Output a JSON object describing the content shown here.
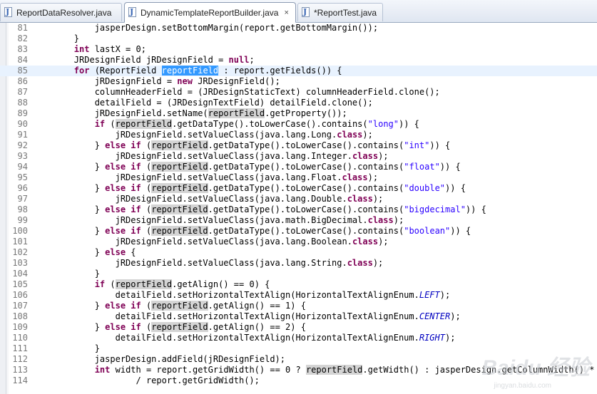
{
  "tabs": [
    {
      "label": "ReportDataResolver.java",
      "active": false
    },
    {
      "label": "DynamicTemplateReportBuilder.java",
      "active": true,
      "close": "×"
    },
    {
      "label": "*ReportTest.java",
      "active": false
    }
  ],
  "lines": [
    {
      "n": "81",
      "t": [
        {
          "s": "            jasperDesign.setBottomMargin(report.getBottomMargin());"
        }
      ]
    },
    {
      "n": "82",
      "t": [
        {
          "s": "        }"
        }
      ]
    },
    {
      "n": "83",
      "t": [
        {
          "s": "        "
        },
        {
          "s": "int",
          "c": "kw"
        },
        {
          "s": " lastX = 0;"
        }
      ]
    },
    {
      "n": "84",
      "t": [
        {
          "s": "        JRDesignField jRDesignField = "
        },
        {
          "s": "null",
          "c": "kw"
        },
        {
          "s": ";"
        }
      ]
    },
    {
      "n": "85",
      "current": true,
      "t": [
        {
          "s": "        "
        },
        {
          "s": "for",
          "c": "kw"
        },
        {
          "s": " (ReportField "
        },
        {
          "s": "reportField",
          "c": "sel"
        },
        {
          "s": " : report.getFields()) {"
        }
      ]
    },
    {
      "n": "86",
      "t": [
        {
          "s": "            jRDesignField = "
        },
        {
          "s": "new",
          "c": "kw"
        },
        {
          "s": " JRDesignField();"
        }
      ]
    },
    {
      "n": "87",
      "t": [
        {
          "s": "            columnHeaderField = (JRDesignStaticText) columnHeaderField.clone();"
        }
      ]
    },
    {
      "n": "88",
      "t": [
        {
          "s": "            detailField = (JRDesignTextField) detailField.clone();"
        }
      ]
    },
    {
      "n": "89",
      "t": [
        {
          "s": "            jRDesignField.setName("
        },
        {
          "s": "reportField",
          "c": "occ"
        },
        {
          "s": ".getProperty());"
        }
      ]
    },
    {
      "n": "90",
      "t": [
        {
          "s": "            "
        },
        {
          "s": "if",
          "c": "kw"
        },
        {
          "s": " ("
        },
        {
          "s": "reportField",
          "c": "occ"
        },
        {
          "s": ".getDataType().toLowerCase().contains("
        },
        {
          "s": "\"long\"",
          "c": "str"
        },
        {
          "s": ")) {"
        }
      ]
    },
    {
      "n": "91",
      "t": [
        {
          "s": "                jRDesignField.setValueClass(java.lang.Long."
        },
        {
          "s": "class",
          "c": "kw"
        },
        {
          "s": ");"
        }
      ]
    },
    {
      "n": "92",
      "t": [
        {
          "s": "            } "
        },
        {
          "s": "else if",
          "c": "kw"
        },
        {
          "s": " ("
        },
        {
          "s": "reportField",
          "c": "occ"
        },
        {
          "s": ".getDataType().toLowerCase().contains("
        },
        {
          "s": "\"int\"",
          "c": "str"
        },
        {
          "s": ")) {"
        }
      ]
    },
    {
      "n": "93",
      "t": [
        {
          "s": "                jRDesignField.setValueClass(java.lang.Integer."
        },
        {
          "s": "class",
          "c": "kw"
        },
        {
          "s": ");"
        }
      ]
    },
    {
      "n": "94",
      "t": [
        {
          "s": "            } "
        },
        {
          "s": "else if",
          "c": "kw"
        },
        {
          "s": " ("
        },
        {
          "s": "reportField",
          "c": "occ"
        },
        {
          "s": ".getDataType().toLowerCase().contains("
        },
        {
          "s": "\"float\"",
          "c": "str"
        },
        {
          "s": ")) {"
        }
      ]
    },
    {
      "n": "95",
      "t": [
        {
          "s": "                jRDesignField.setValueClass(java.lang.Float."
        },
        {
          "s": "class",
          "c": "kw"
        },
        {
          "s": ");"
        }
      ]
    },
    {
      "n": "96",
      "t": [
        {
          "s": "            } "
        },
        {
          "s": "else if",
          "c": "kw"
        },
        {
          "s": " ("
        },
        {
          "s": "reportField",
          "c": "occ"
        },
        {
          "s": ".getDataType().toLowerCase().contains("
        },
        {
          "s": "\"double\"",
          "c": "str"
        },
        {
          "s": ")) {"
        }
      ]
    },
    {
      "n": "97",
      "t": [
        {
          "s": "                jRDesignField.setValueClass(java.lang.Double."
        },
        {
          "s": "class",
          "c": "kw"
        },
        {
          "s": ");"
        }
      ]
    },
    {
      "n": "98",
      "t": [
        {
          "s": "            } "
        },
        {
          "s": "else if",
          "c": "kw"
        },
        {
          "s": " ("
        },
        {
          "s": "reportField",
          "c": "occ"
        },
        {
          "s": ".getDataType().toLowerCase().contains("
        },
        {
          "s": "\"bigdecimal\"",
          "c": "str"
        },
        {
          "s": ")) {"
        }
      ]
    },
    {
      "n": "99",
      "t": [
        {
          "s": "                jRDesignField.setValueClass(java.math.BigDecimal."
        },
        {
          "s": "class",
          "c": "kw"
        },
        {
          "s": ");"
        }
      ]
    },
    {
      "n": "100",
      "t": [
        {
          "s": "            } "
        },
        {
          "s": "else if",
          "c": "kw"
        },
        {
          "s": " ("
        },
        {
          "s": "reportField",
          "c": "occ"
        },
        {
          "s": ".getDataType().toLowerCase().contains("
        },
        {
          "s": "\"boolean\"",
          "c": "str"
        },
        {
          "s": ")) {"
        }
      ]
    },
    {
      "n": "101",
      "t": [
        {
          "s": "                jRDesignField.setValueClass(java.lang.Boolean."
        },
        {
          "s": "class",
          "c": "kw"
        },
        {
          "s": ");"
        }
      ]
    },
    {
      "n": "102",
      "t": [
        {
          "s": "            } "
        },
        {
          "s": "else",
          "c": "kw"
        },
        {
          "s": " {"
        }
      ]
    },
    {
      "n": "103",
      "t": [
        {
          "s": "                jRDesignField.setValueClass(java.lang.String."
        },
        {
          "s": "class",
          "c": "kw"
        },
        {
          "s": ");"
        }
      ]
    },
    {
      "n": "104",
      "t": [
        {
          "s": "            }"
        }
      ]
    },
    {
      "n": "105",
      "t": [
        {
          "s": "            "
        },
        {
          "s": "if",
          "c": "kw"
        },
        {
          "s": " ("
        },
        {
          "s": "reportField",
          "c": "occ"
        },
        {
          "s": ".getAlign() == 0) {"
        }
      ]
    },
    {
      "n": "106",
      "t": [
        {
          "s": "                detailField.setHorizontalTextAlign(HorizontalTextAlignEnum."
        },
        {
          "s": "LEFT",
          "c": "it"
        },
        {
          "s": ");"
        }
      ]
    },
    {
      "n": "107",
      "t": [
        {
          "s": "            } "
        },
        {
          "s": "else if",
          "c": "kw"
        },
        {
          "s": " ("
        },
        {
          "s": "reportField",
          "c": "occ"
        },
        {
          "s": ".getAlign() == 1) {"
        }
      ]
    },
    {
      "n": "108",
      "t": [
        {
          "s": "                detailField.setHorizontalTextAlign(HorizontalTextAlignEnum."
        },
        {
          "s": "CENTER",
          "c": "it"
        },
        {
          "s": ");"
        }
      ]
    },
    {
      "n": "109",
      "t": [
        {
          "s": "            } "
        },
        {
          "s": "else if",
          "c": "kw"
        },
        {
          "s": " ("
        },
        {
          "s": "reportField",
          "c": "occ"
        },
        {
          "s": ".getAlign() == 2) {"
        }
      ]
    },
    {
      "n": "110",
      "t": [
        {
          "s": "                detailField.setHorizontalTextAlign(HorizontalTextAlignEnum."
        },
        {
          "s": "RIGHT",
          "c": "it"
        },
        {
          "s": ");"
        }
      ]
    },
    {
      "n": "111",
      "t": [
        {
          "s": "            }"
        }
      ]
    },
    {
      "n": "112",
      "t": [
        {
          "s": "            jasperDesign.addField(jRDesignField);"
        }
      ]
    },
    {
      "n": "113",
      "t": [
        {
          "s": "            "
        },
        {
          "s": "int",
          "c": "kw"
        },
        {
          "s": " width = report.getGridWidth() == 0 ? "
        },
        {
          "s": "reportField",
          "c": "occ"
        },
        {
          "s": ".getWidth() : jasperDesign.getColumnWidth() * rep"
        }
      ]
    },
    {
      "n": "114",
      "t": [
        {
          "s": "                    / report.getGridWidth();"
        }
      ]
    }
  ],
  "watermark": {
    "text": "Baidu 经验",
    "sub": "jingyan.baidu.com"
  }
}
